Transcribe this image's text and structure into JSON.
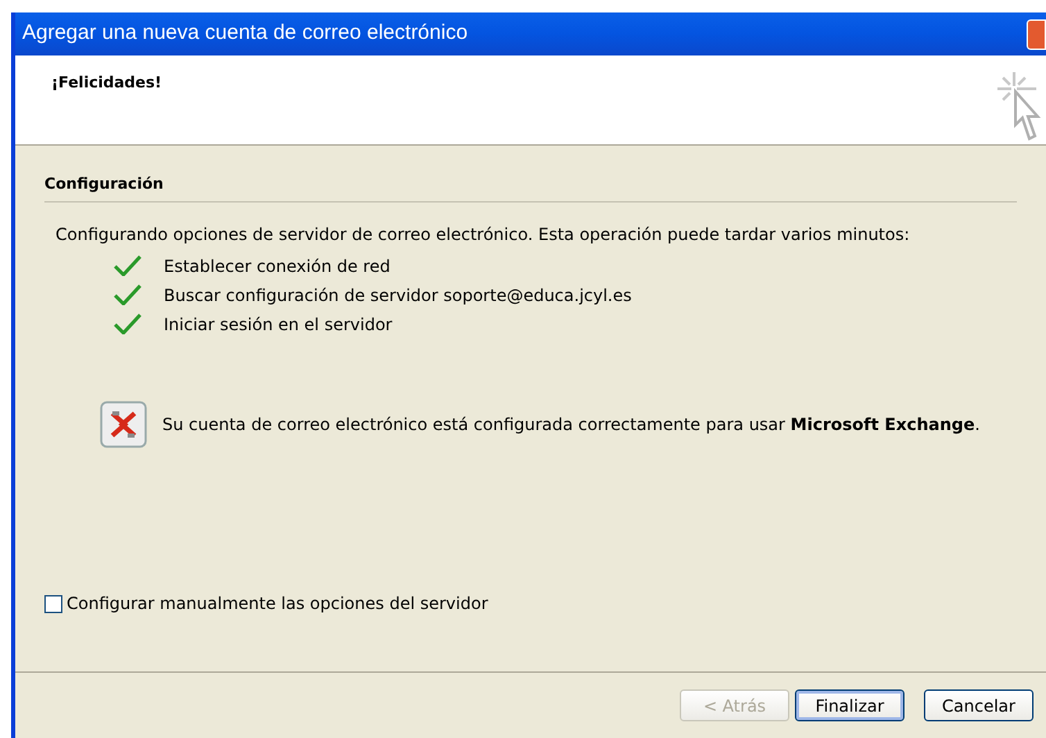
{
  "window": {
    "title": "Agregar una nueva cuenta de correo electrónico"
  },
  "header": {
    "title": "¡Felicidades!"
  },
  "section": {
    "title": "Configuración",
    "intro": "Configurando opciones de servidor de correo electrónico. Esta operación puede tardar varios minutos:"
  },
  "steps": [
    {
      "label": "Establecer conexión de red",
      "done": true
    },
    {
      "label": "Buscar configuración de servidor soporte@educa.jcyl.es",
      "done": true
    },
    {
      "label": "Iniciar sesión en el servidor",
      "done": true
    }
  ],
  "result": {
    "message": "Su cuenta de correo electrónico está configurada correctamente para usar **Microsoft Exchange**."
  },
  "manual_checkbox": {
    "label": "Configurar manualmente las opciones del servidor",
    "checked": false
  },
  "buttons": [
    {
      "label": "< Atrás",
      "disabled": true,
      "default": false
    },
    {
      "label": "Finalizar",
      "disabled": false,
      "default": true
    },
    {
      "label": "Cancelar",
      "disabled": false,
      "default": false
    }
  ]
}
